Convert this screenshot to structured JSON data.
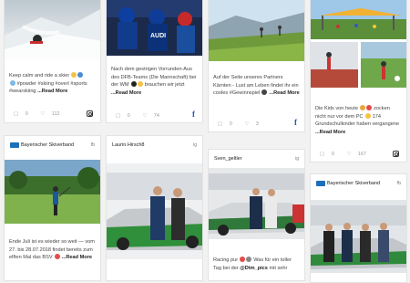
{
  "cards": [
    {
      "caption": "Keep calm and ride a skier",
      "tags": "#powder #skiing #overl #sports #wearskiing",
      "more": "...Read More",
      "views": "0",
      "likes": "112",
      "network": "instagram-icon"
    },
    {
      "caption": "Nach dem gestrigen Vorrunden-Aus des DFB-Teams (Die Mannschaft) bei der WM",
      "caption2": "brauchen wir jetzt",
      "more": "...Read More",
      "views": "0",
      "likes": "74",
      "network": "facebook-icon"
    },
    {
      "caption": "Auf der Seite unseres Partners Kärnten - Lust am Leben findet ihr ein cooles #Gewinnspiel",
      "more": "...Read More",
      "views": "0",
      "likes": "3",
      "network": "facebook-icon"
    },
    {
      "caption": "Die Kids von heute",
      "caption2": "zocken nicht nur vor dem PC",
      "caption3": "174 Grundschulkinder haben vergangene",
      "more": "...Read More",
      "views": "0",
      "likes": "167",
      "network": "instagram-icon"
    },
    {
      "author": "Bayerischer Skiverband",
      "caption": "Ende Juli ist es wieder so weit — vom 27. bis 28.07.2018 findet bereits zum elften Mal das BSV",
      "more": "...Read More",
      "badge": "fb"
    },
    {
      "author": "Laurin.Hirsch8",
      "badge": "ig"
    },
    {
      "author": "Sven_geltler",
      "caption": "Racing pur",
      "caption2": "Was für ein toller Tag bei der",
      "handle": "@Dtm_pics",
      "caption3": "mit sehr",
      "badge": "ig"
    },
    {
      "author": "Bayerischer Skiverband",
      "badge": "fb"
    }
  ],
  "colors": {
    "facebook": "#1e5bb5",
    "skiverband": "#1d6fb8",
    "accent_orange": "#f0a400"
  }
}
